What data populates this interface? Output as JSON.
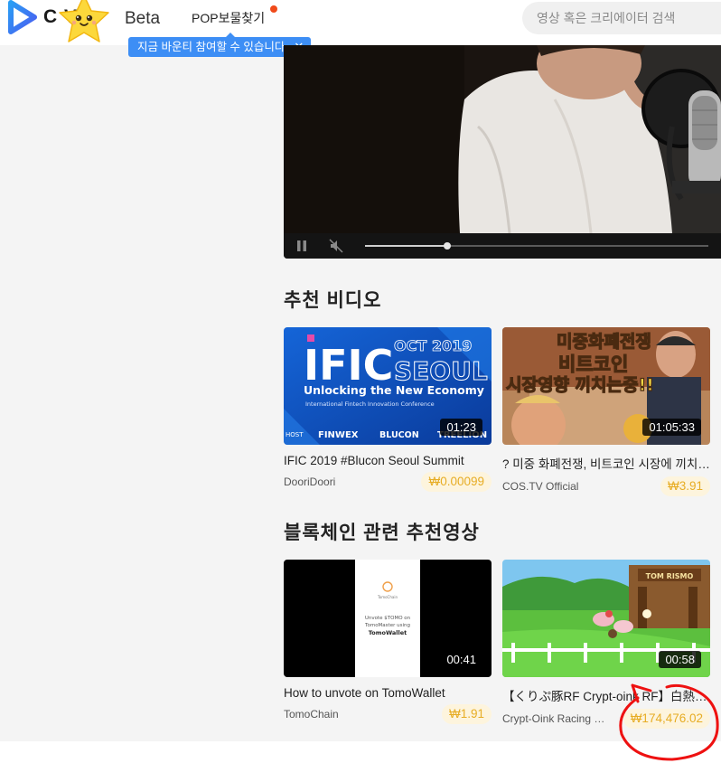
{
  "header": {
    "logo_text": "C     V",
    "logo_beta": "Beta",
    "nav_pop": "POP보물찾기",
    "tooltip_text": "지금 바운티 참여할 수 있습니다",
    "tooltip_close": "✕",
    "search_placeholder": "영상 혹은 크리에이터 검색"
  },
  "player": {
    "progress_fraction": 0.24
  },
  "sections": [
    {
      "title": "추천 비디오",
      "cards": [
        {
          "title": "IFIC 2019 #Blucon Seoul Summit",
          "channel": "DooriDoori",
          "price": "₩0.00099",
          "duration": "01:23",
          "thumb_texts": {
            "big": "IFIC",
            "oct": "OCT 2019",
            "city": "SEOUL",
            "tagline": "Unlocking the New Economy",
            "sub": "International Fintech Innovation Conference",
            "host": "HOST",
            "s1": "FINWEX",
            "s2": "BLUCON",
            "s3": "TREELION"
          }
        },
        {
          "title": "? 미중 화폐전쟁, 비트코인 시장에 끼치는 영향",
          "channel": "COS.TV Official",
          "price": "₩3.91",
          "duration": "01:05:33",
          "thumb_texts": {
            "l1": "미중화폐전쟁",
            "l2": "비트코인",
            "l3": "시장영향 끼치는중!!"
          }
        }
      ]
    },
    {
      "title": "블록체인 관련 추천영상",
      "cards": [
        {
          "title": "How to unvote on TomoWallet",
          "channel": "TomoChain",
          "price": "₩1.91",
          "duration": "00:41",
          "thumb_texts": {
            "brand": "TomoChain",
            "l1": "Unvote $TOMO on",
            "l2": "TomoMaster using",
            "l3": "TomoWallet"
          }
        },
        {
          "title": "【くりぷ豚RF Crypt-oink RF】白熱のレース",
          "channel": "Crypt-Oink Racing Fes",
          "price": "₩174,476.02",
          "duration": "00:58",
          "thumb_texts": {
            "sign": "TOM RISMO"
          }
        }
      ]
    }
  ]
}
